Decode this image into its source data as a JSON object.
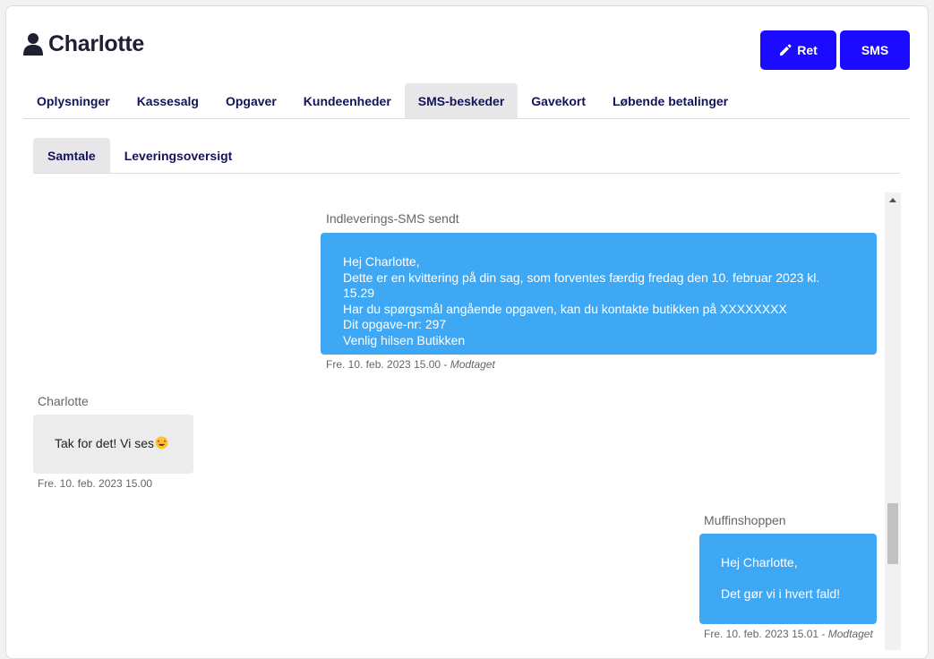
{
  "header": {
    "title": "Charlotte",
    "title_icon": "user-icon",
    "edit_label": "Ret",
    "edit_icon": "pencil-icon",
    "sms_label": "SMS",
    "accent_color": "#1a0aff"
  },
  "tabs": [
    {
      "label": "Oplysninger",
      "active": false
    },
    {
      "label": "Kassesalg",
      "active": false
    },
    {
      "label": "Opgaver",
      "active": false
    },
    {
      "label": "Kundeenheder",
      "active": false
    },
    {
      "label": "SMS-beskeder",
      "active": true
    },
    {
      "label": "Gavekort",
      "active": false
    },
    {
      "label": "Løbende betalinger",
      "active": false
    }
  ],
  "subtabs": [
    {
      "label": "Samtale",
      "active": true
    },
    {
      "label": "Leveringsoversigt",
      "active": false
    }
  ],
  "messages": [
    {
      "sender": "Indleverings-SMS sendt",
      "direction": "outgoing",
      "lines": [
        "Hej Charlotte,",
        "Dette er en kvittering på din sag, som forventes færdig fredag den 10. februar 2023 kl. 15.29",
        "Har du spørgsmål angående opgaven, kan du kontakte butikken på XXXXXXXX",
        "Dit opgave-nr: 297",
        "Venlig hilsen Butikken"
      ],
      "timestamp": "Fre. 10. feb. 2023 15.00",
      "status": "Modtaget"
    },
    {
      "sender": "Charlotte",
      "direction": "incoming",
      "lines": [
        "Tak for det! Vi ses"
      ],
      "emoji": "smiling-face-with-heart-eyes-icon",
      "timestamp": "Fre. 10. feb. 2023 15.00",
      "status": ""
    },
    {
      "sender": "Muffinshoppen",
      "direction": "outgoing",
      "lines": [
        "Hej Charlotte,",
        "",
        "Det gør vi i hvert fald!"
      ],
      "timestamp": "Fre. 10. feb. 2023 15.01",
      "status": "Modtaget"
    }
  ],
  "colors": {
    "outgoing_bubble": "#3ea8f5",
    "incoming_bubble": "#ececec",
    "tab_text": "#13135a"
  }
}
